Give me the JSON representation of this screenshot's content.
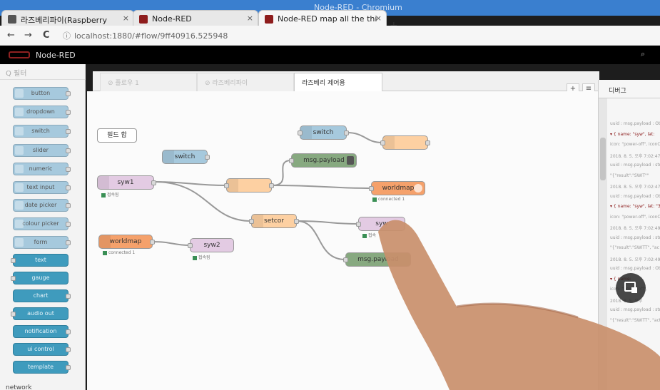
{
  "window": {
    "title": "Node-RED - Chromium"
  },
  "browser": {
    "tabs": [
      {
        "label": "라즈베리파이(Raspberry",
        "close": "×"
      },
      {
        "label": "Node-RED",
        "close": "×"
      },
      {
        "label": "Node-RED map all the thi",
        "close": "×"
      }
    ],
    "new_tab": "+",
    "back": "←",
    "forward": "→",
    "reload": "C",
    "info": "ⓘ",
    "url": "localhost:1880/#flow/9ff40916.525948"
  },
  "nodered": {
    "brand": "Node-RED",
    "zoom_icon": "⌕",
    "filter_placeholder": "Q 필터",
    "palette": [
      {
        "label": "button"
      },
      {
        "label": "dropdown"
      },
      {
        "label": "switch"
      },
      {
        "label": "slider"
      },
      {
        "label": "numeric"
      },
      {
        "label": "text input"
      },
      {
        "label": "date picker"
      },
      {
        "label": "colour picker"
      },
      {
        "label": "form"
      },
      {
        "label": "text"
      },
      {
        "label": "gauge"
      },
      {
        "label": "chart"
      },
      {
        "label": "audio out"
      },
      {
        "label": "notification"
      },
      {
        "label": "ui control"
      },
      {
        "label": "template"
      }
    ],
    "palette_category": "network",
    "flow_tabs": [
      {
        "label": "⊘ 플로우 1"
      },
      {
        "label": "⊘ 라즈베리파이"
      },
      {
        "label": "라즈베리 제어용"
      }
    ],
    "tab_add": "+",
    "tab_menu": "≡",
    "sidebar_title": "디버그",
    "debug_lines": [
      "uuid : msg.payload : Obj",
      "▾ { name: \"syw\", lat:",
      "icon: \"power-off\", iconC",
      "2018. 8. 5. 오후 7:02:47",
      "uuid : msg.payload : strin",
      "\"{\"result\":\"SWIT\"\"",
      "2018. 8. 5. 오후 7:02:47",
      "uuid : msg.payload : Obje",
      "▾ { name: \"syw\", lat: \"3",
      "icon: \"power-off\", iconCo",
      "2018. 8. 5. 오후 7:02:49",
      "uuid : msg.payload : strin",
      "\"{\"result\":\"SWITT\", \"ac",
      "2018. 8. 5. 오후 7:02:49",
      "uuid : msg.payload : Object",
      "▾ { name:",
      "icon: \"power-off\",",
      "2018. 8. 5. 오후",
      "uuid : msg.payload : strin",
      "\"{\"result\":\"SWITT\", \"act"
    ],
    "flow": {
      "comment": "필드 합",
      "switch_1": "switch",
      "switch_2": "switch",
      "msg_payload_1": "msg.payload",
      "syw1": "syw1",
      "syw1_status": "접속됨",
      "worldmap_out": "worldmap",
      "worldmap_out_status": "connected 1",
      "setcor": "setcor",
      "syw_right": "syw",
      "syw_right_status": "접속",
      "msg_payload_2": "msg.payload",
      "worldmap_in": "worldmap",
      "worldmap_in_status": "connected 1",
      "syw2": "syw2",
      "syw2_status": "접속됨"
    }
  },
  "colors": {
    "ui_node": "#a6c9dd",
    "ui_node_dark": "#3f9bbd",
    "function_node": "#fdd0a2",
    "debug_node": "#87a980",
    "worldmap_node": "#f5a16b",
    "link_node": "#e3cbe3"
  }
}
